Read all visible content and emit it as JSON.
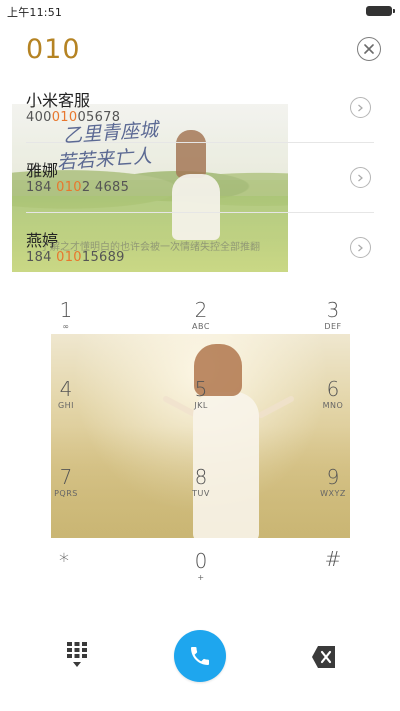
{
  "status_bar": {
    "time": "上午11:51"
  },
  "dialer": {
    "input_value": "010",
    "clear_icon": "close-circle-icon"
  },
  "contacts": [
    {
      "name": "小米客服",
      "number_parts": [
        "400",
        "010",
        "05678"
      ]
    },
    {
      "name": "雅娜",
      "number_parts": [
        "184 ",
        "010",
        "2 4685"
      ]
    },
    {
      "name": "燕婷",
      "number_parts": [
        "184 ",
        "010",
        "15689"
      ]
    }
  ],
  "photo_overlay": {
    "calligraphy_line1": "乙里青座城",
    "calligraphy_line2": "若若来亡人",
    "caption": "了解之才懂明白的也许会被一次情绪失控全部推翻"
  },
  "keypad": {
    "keys": [
      {
        "digit": "1",
        "letters": "∞"
      },
      {
        "digit": "2",
        "letters": "ABC"
      },
      {
        "digit": "3",
        "letters": "DEF"
      },
      {
        "digit": "4",
        "letters": "GHI"
      },
      {
        "digit": "5",
        "letters": "JKL"
      },
      {
        "digit": "6",
        "letters": "MNO"
      },
      {
        "digit": "7",
        "letters": "PQRS"
      },
      {
        "digit": "8",
        "letters": "TUV"
      },
      {
        "digit": "9",
        "letters": "WXYZ"
      },
      {
        "digit": "*",
        "letters": ""
      },
      {
        "digit": "0",
        "letters": "+"
      },
      {
        "digit": "#",
        "letters": ""
      }
    ]
  },
  "actions": {
    "keypad_toggle_icon": "dialpad-icon",
    "call_icon": "phone-icon",
    "delete_icon": "backspace-icon",
    "call_color": "#1ea6ee",
    "accent_color": "#b58323",
    "highlight_color": "#e8772e"
  }
}
